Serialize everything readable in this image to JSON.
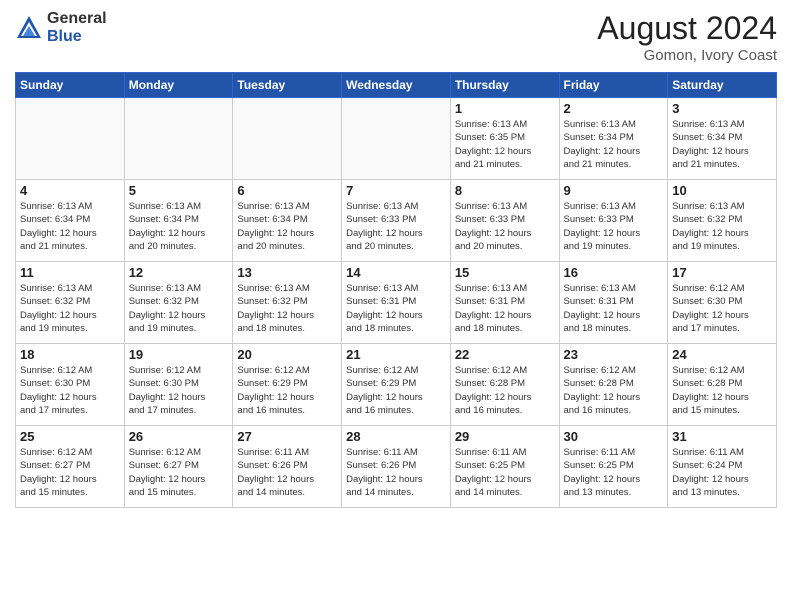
{
  "header": {
    "logo_general": "General",
    "logo_blue": "Blue",
    "month_year": "August 2024",
    "location": "Gomon, Ivory Coast"
  },
  "days_of_week": [
    "Sunday",
    "Monday",
    "Tuesday",
    "Wednesday",
    "Thursday",
    "Friday",
    "Saturday"
  ],
  "weeks": [
    [
      {
        "day": "",
        "info": ""
      },
      {
        "day": "",
        "info": ""
      },
      {
        "day": "",
        "info": ""
      },
      {
        "day": "",
        "info": ""
      },
      {
        "day": "1",
        "info": "Sunrise: 6:13 AM\nSunset: 6:35 PM\nDaylight: 12 hours\nand 21 minutes."
      },
      {
        "day": "2",
        "info": "Sunrise: 6:13 AM\nSunset: 6:34 PM\nDaylight: 12 hours\nand 21 minutes."
      },
      {
        "day": "3",
        "info": "Sunrise: 6:13 AM\nSunset: 6:34 PM\nDaylight: 12 hours\nand 21 minutes."
      }
    ],
    [
      {
        "day": "4",
        "info": "Sunrise: 6:13 AM\nSunset: 6:34 PM\nDaylight: 12 hours\nand 21 minutes."
      },
      {
        "day": "5",
        "info": "Sunrise: 6:13 AM\nSunset: 6:34 PM\nDaylight: 12 hours\nand 20 minutes."
      },
      {
        "day": "6",
        "info": "Sunrise: 6:13 AM\nSunset: 6:34 PM\nDaylight: 12 hours\nand 20 minutes."
      },
      {
        "day": "7",
        "info": "Sunrise: 6:13 AM\nSunset: 6:33 PM\nDaylight: 12 hours\nand 20 minutes."
      },
      {
        "day": "8",
        "info": "Sunrise: 6:13 AM\nSunset: 6:33 PM\nDaylight: 12 hours\nand 20 minutes."
      },
      {
        "day": "9",
        "info": "Sunrise: 6:13 AM\nSunset: 6:33 PM\nDaylight: 12 hours\nand 19 minutes."
      },
      {
        "day": "10",
        "info": "Sunrise: 6:13 AM\nSunset: 6:32 PM\nDaylight: 12 hours\nand 19 minutes."
      }
    ],
    [
      {
        "day": "11",
        "info": "Sunrise: 6:13 AM\nSunset: 6:32 PM\nDaylight: 12 hours\nand 19 minutes."
      },
      {
        "day": "12",
        "info": "Sunrise: 6:13 AM\nSunset: 6:32 PM\nDaylight: 12 hours\nand 19 minutes."
      },
      {
        "day": "13",
        "info": "Sunrise: 6:13 AM\nSunset: 6:32 PM\nDaylight: 12 hours\nand 18 minutes."
      },
      {
        "day": "14",
        "info": "Sunrise: 6:13 AM\nSunset: 6:31 PM\nDaylight: 12 hours\nand 18 minutes."
      },
      {
        "day": "15",
        "info": "Sunrise: 6:13 AM\nSunset: 6:31 PM\nDaylight: 12 hours\nand 18 minutes."
      },
      {
        "day": "16",
        "info": "Sunrise: 6:13 AM\nSunset: 6:31 PM\nDaylight: 12 hours\nand 18 minutes."
      },
      {
        "day": "17",
        "info": "Sunrise: 6:12 AM\nSunset: 6:30 PM\nDaylight: 12 hours\nand 17 minutes."
      }
    ],
    [
      {
        "day": "18",
        "info": "Sunrise: 6:12 AM\nSunset: 6:30 PM\nDaylight: 12 hours\nand 17 minutes."
      },
      {
        "day": "19",
        "info": "Sunrise: 6:12 AM\nSunset: 6:30 PM\nDaylight: 12 hours\nand 17 minutes."
      },
      {
        "day": "20",
        "info": "Sunrise: 6:12 AM\nSunset: 6:29 PM\nDaylight: 12 hours\nand 16 minutes."
      },
      {
        "day": "21",
        "info": "Sunrise: 6:12 AM\nSunset: 6:29 PM\nDaylight: 12 hours\nand 16 minutes."
      },
      {
        "day": "22",
        "info": "Sunrise: 6:12 AM\nSunset: 6:28 PM\nDaylight: 12 hours\nand 16 minutes."
      },
      {
        "day": "23",
        "info": "Sunrise: 6:12 AM\nSunset: 6:28 PM\nDaylight: 12 hours\nand 16 minutes."
      },
      {
        "day": "24",
        "info": "Sunrise: 6:12 AM\nSunset: 6:28 PM\nDaylight: 12 hours\nand 15 minutes."
      }
    ],
    [
      {
        "day": "25",
        "info": "Sunrise: 6:12 AM\nSunset: 6:27 PM\nDaylight: 12 hours\nand 15 minutes."
      },
      {
        "day": "26",
        "info": "Sunrise: 6:12 AM\nSunset: 6:27 PM\nDaylight: 12 hours\nand 15 minutes."
      },
      {
        "day": "27",
        "info": "Sunrise: 6:11 AM\nSunset: 6:26 PM\nDaylight: 12 hours\nand 14 minutes."
      },
      {
        "day": "28",
        "info": "Sunrise: 6:11 AM\nSunset: 6:26 PM\nDaylight: 12 hours\nand 14 minutes."
      },
      {
        "day": "29",
        "info": "Sunrise: 6:11 AM\nSunset: 6:25 PM\nDaylight: 12 hours\nand 14 minutes."
      },
      {
        "day": "30",
        "info": "Sunrise: 6:11 AM\nSunset: 6:25 PM\nDaylight: 12 hours\nand 13 minutes."
      },
      {
        "day": "31",
        "info": "Sunrise: 6:11 AM\nSunset: 6:24 PM\nDaylight: 12 hours\nand 13 minutes."
      }
    ]
  ]
}
